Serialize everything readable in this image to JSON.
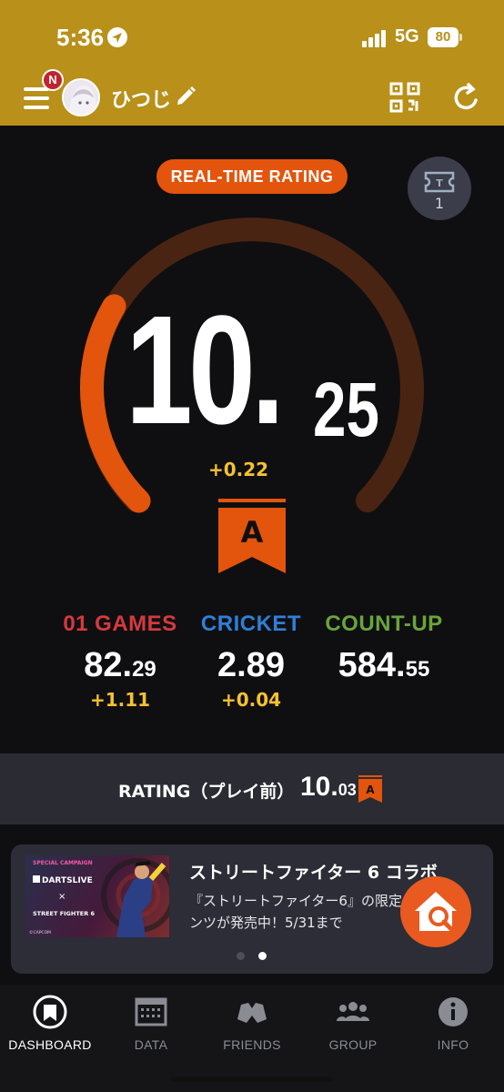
{
  "status_bar": {
    "time": "5:36",
    "network": "5G",
    "battery": "80"
  },
  "header": {
    "notification_badge": "N",
    "username": "ひつじ"
  },
  "realtime": {
    "label": "REAL-TIME RATING",
    "ticket_count": "1",
    "rating_int": "10.",
    "rating_dec": "25",
    "delta": "+0.22",
    "class": "A",
    "gauge_fraction": 0.28
  },
  "stats": [
    {
      "label": "01 GAMES",
      "value_main": "82.",
      "value_small": "29",
      "delta": "+1.11",
      "color": "#d63a3d"
    },
    {
      "label": "CRICKET",
      "value_main": "2.89",
      "value_small": "",
      "delta": "+0.04",
      "color": "#2f7fd8"
    },
    {
      "label": "COUNT-UP",
      "value_main": "584.",
      "value_small": "55",
      "delta": "",
      "color": "#6aa53a"
    }
  ],
  "pre_rating": {
    "label": "RATING（プレイ前）",
    "value_main": "10.",
    "value_small": "03",
    "class": "A"
  },
  "banner": {
    "image_tag": "SPECIAL CAMPAIGN",
    "image_brand": "DARTSLIVE",
    "image_x": "×",
    "image_collab": "STREET FIGHTER 6",
    "image_copy": "©CAPCOM",
    "title": "ストリートファイター 6 コラボ",
    "text": "『ストリートファイター6』の限定コンテンツが発売中！5/31まで",
    "active_dot": 1
  },
  "tabs": [
    {
      "label": "DASHBOARD",
      "icon": "dashboard-icon",
      "active": true
    },
    {
      "label": "DATA",
      "icon": "data-icon",
      "active": false
    },
    {
      "label": "FRIENDS",
      "icon": "friends-icon",
      "active": false
    },
    {
      "label": "GROUP",
      "icon": "group-icon",
      "active": false
    },
    {
      "label": "INFO",
      "icon": "info-icon",
      "active": false
    }
  ],
  "colors": {
    "header": "#b8901a",
    "accent": "#e3540c",
    "gauge_track": "#4a2412",
    "delta": "#f4c130",
    "background": "#0f0f12"
  }
}
